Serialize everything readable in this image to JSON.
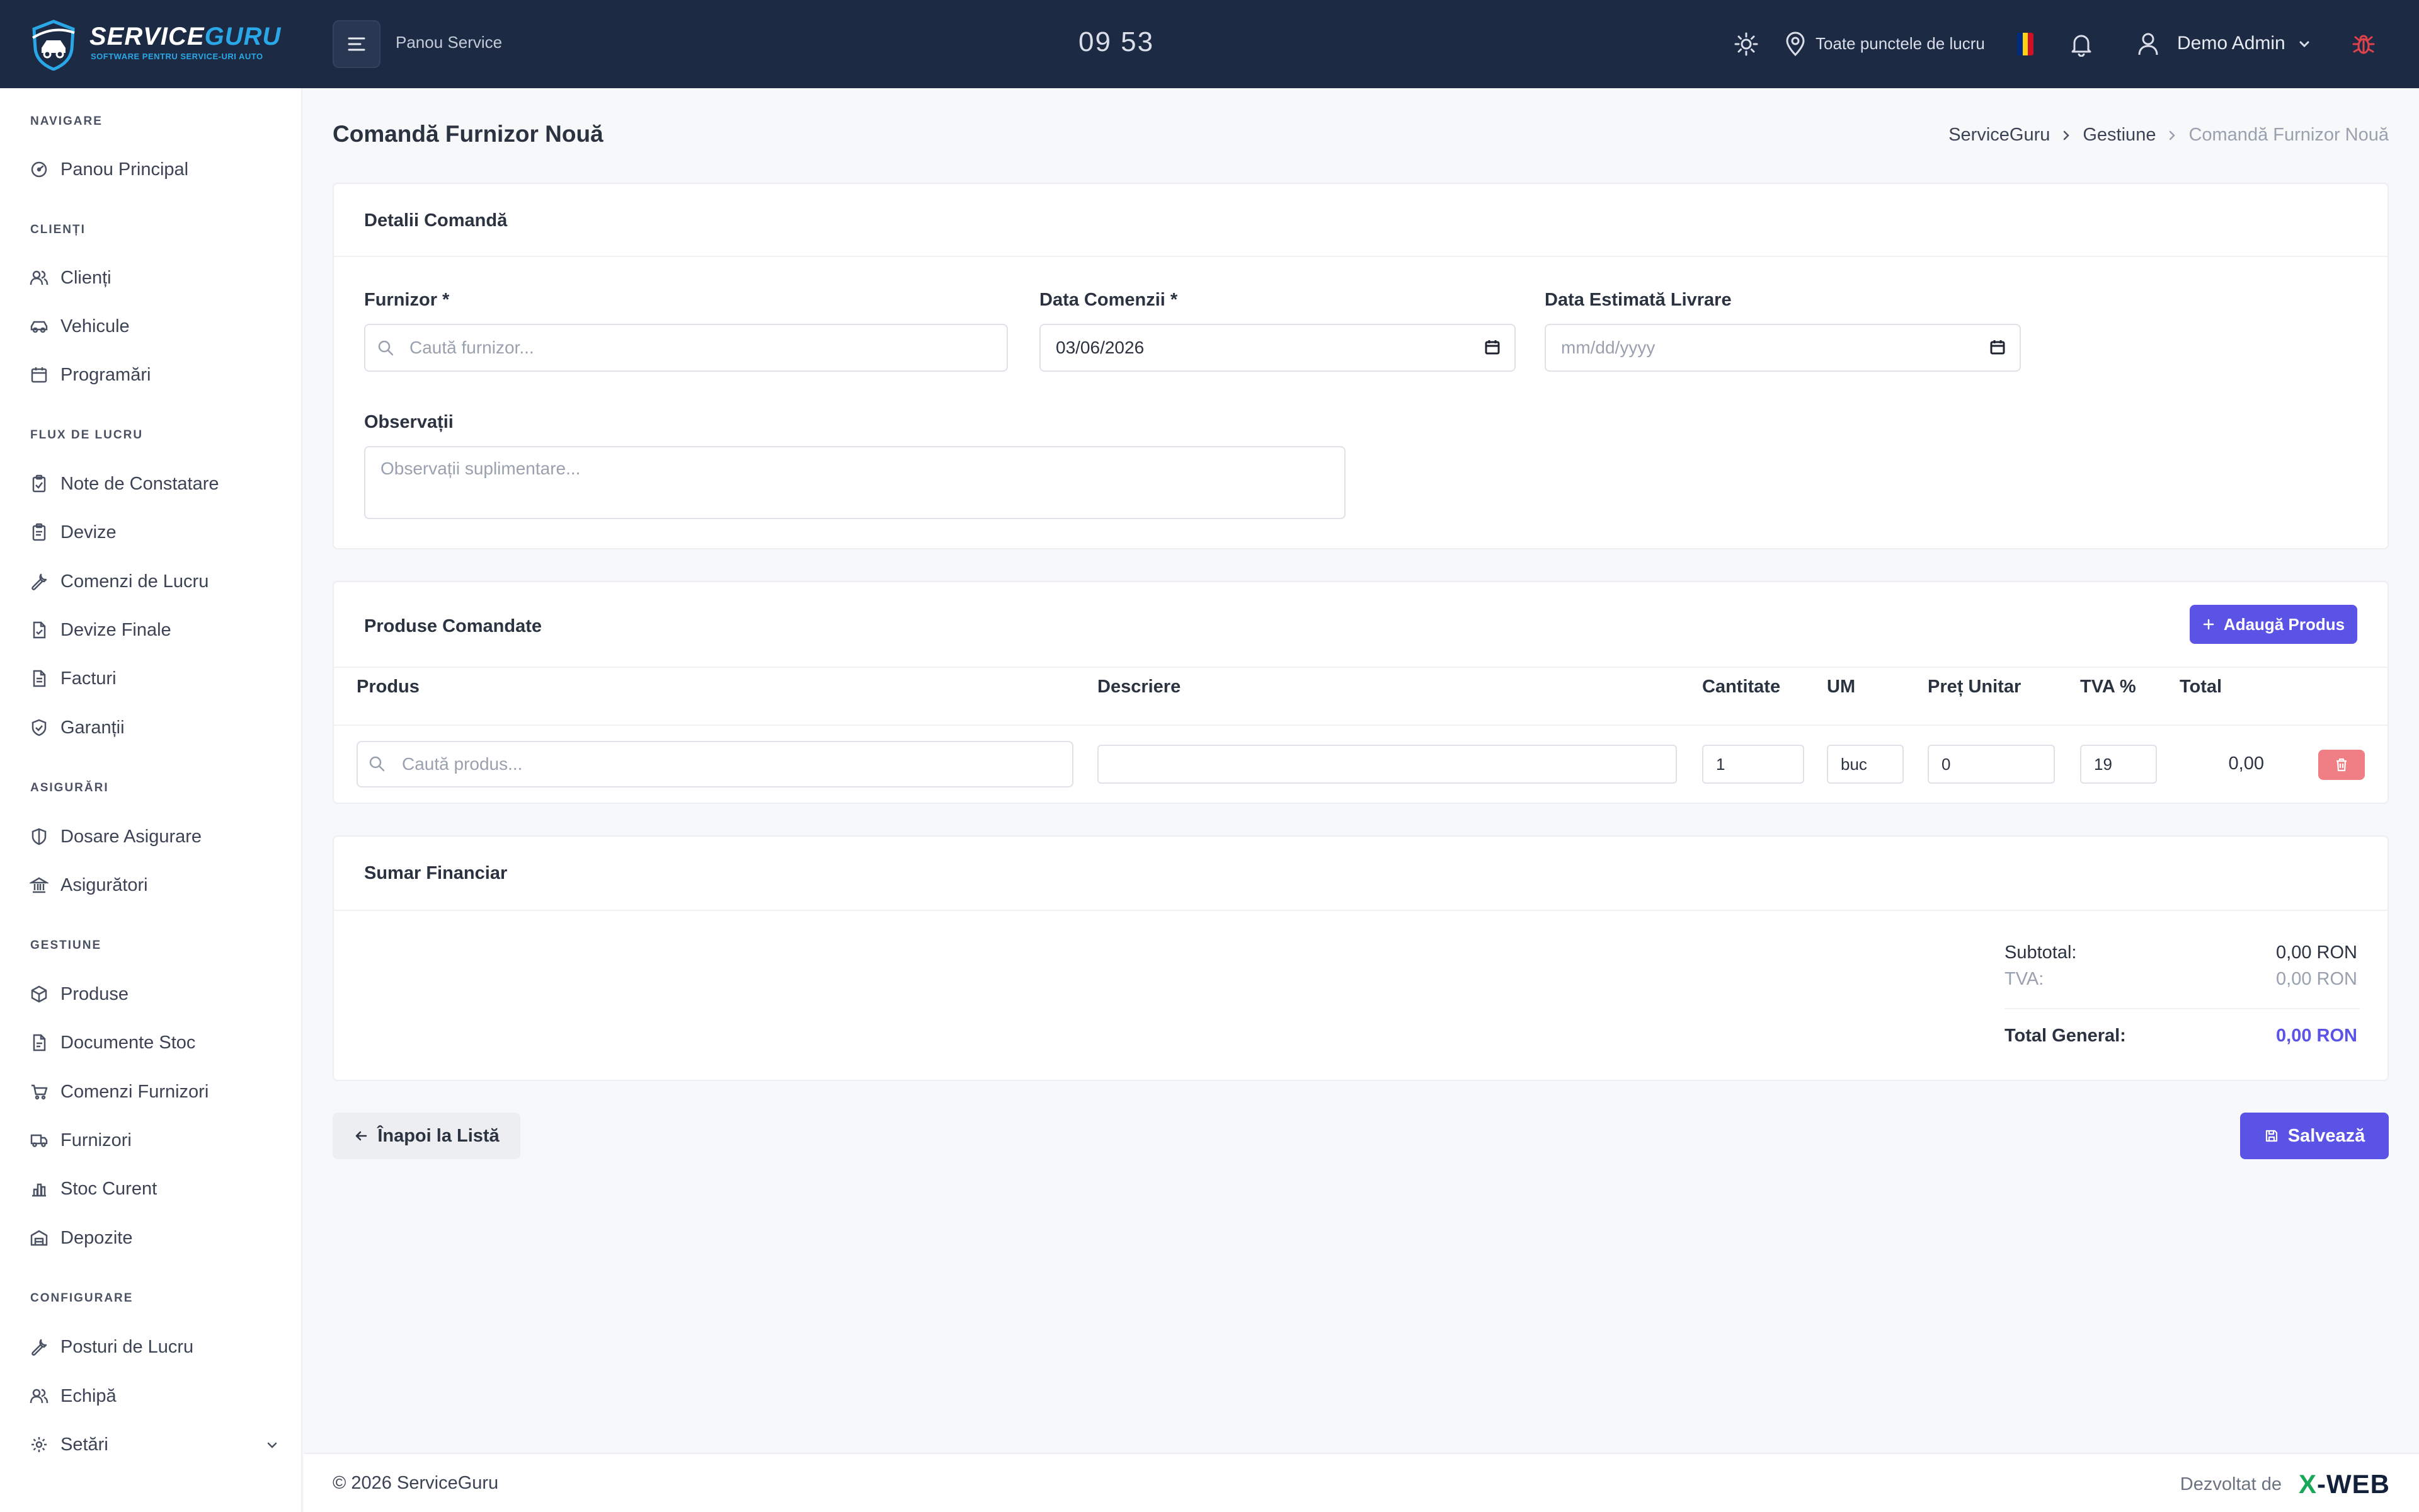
{
  "header": {
    "logo_text_main": "SERVICE",
    "logo_text_accent": "GURU",
    "logo_tagline": "SOFTWARE PENTRU SERVICE-URI AUTO",
    "panel_title": "Panou Service",
    "clock": "09 53",
    "location_label": "Toate punctele de lucru",
    "user_name": "Demo Admin",
    "flag_colors": [
      "#002b7f",
      "#fcd116",
      "#ce1126"
    ],
    "icons": [
      "menu-icon",
      "sun-icon",
      "map-pin-icon",
      "bell-icon",
      "user-icon",
      "chevron-down-icon",
      "bug-icon"
    ]
  },
  "sidebar": {
    "sections": [
      {
        "title": "NAVIGARE",
        "items": [
          {
            "label": "Panou Principal",
            "icon": "dashboard-icon"
          }
        ]
      },
      {
        "title": "CLIENȚI",
        "items": [
          {
            "label": "Clienți",
            "icon": "users-icon"
          },
          {
            "label": "Vehicule",
            "icon": "car-icon"
          },
          {
            "label": "Programări",
            "icon": "calendar-icon"
          }
        ]
      },
      {
        "title": "FLUX DE LUCRU",
        "items": [
          {
            "label": "Note de Constatare",
            "icon": "clipboard-check-icon"
          },
          {
            "label": "Devize",
            "icon": "clipboard-icon"
          },
          {
            "label": "Comenzi de Lucru",
            "icon": "wrench-icon"
          },
          {
            "label": "Devize Finale",
            "icon": "file-check-icon"
          },
          {
            "label": "Facturi",
            "icon": "receipt-icon"
          },
          {
            "label": "Garanții",
            "icon": "shield-check-icon"
          }
        ]
      },
      {
        "title": "ASIGURĂRI",
        "items": [
          {
            "label": "Dosare Asigurare",
            "icon": "shield-icon"
          },
          {
            "label": "Asigurători",
            "icon": "building-icon"
          }
        ]
      },
      {
        "title": "GESTIUNE",
        "items": [
          {
            "label": "Produse",
            "icon": "box-icon"
          },
          {
            "label": "Documente Stoc",
            "icon": "file-icon"
          },
          {
            "label": "Comenzi Furnizori",
            "icon": "cart-icon"
          },
          {
            "label": "Furnizori",
            "icon": "truck-icon"
          },
          {
            "label": "Stoc Curent",
            "icon": "bar-chart-icon"
          },
          {
            "label": "Depozite",
            "icon": "warehouse-icon"
          }
        ]
      },
      {
        "title": "CONFIGURARE",
        "items": [
          {
            "label": "Posturi de Lucru",
            "icon": "wrench-icon"
          },
          {
            "label": "Echipă",
            "icon": "team-icon"
          },
          {
            "label": "Setări",
            "icon": "gear-icon"
          }
        ]
      }
    ]
  },
  "page": {
    "title": "Comandă Furnizor Nouă",
    "breadcrumb": [
      "ServiceGuru",
      "Gestiune",
      "Comandă Furnizor Nouă"
    ]
  },
  "details": {
    "title": "Detalii Comandă",
    "supplier_label": "Furnizor *",
    "supplier_placeholder": "Caută furnizor...",
    "order_date_label": "Data Comenzii *",
    "order_date_value": "03/06/2026",
    "delivery_label": "Data Estimată Livrare",
    "delivery_placeholder": "mm/dd/yyyy",
    "notes_label": "Observații",
    "notes_placeholder": "Observații suplimentare..."
  },
  "products": {
    "title": "Produse Comandate",
    "add_button": "Adaugă Produs",
    "columns": [
      "Produs",
      "Descriere",
      "Cantitate",
      "UM",
      "Preț Unitar",
      "TVA %",
      "Total"
    ],
    "rows": [
      {
        "product_placeholder": "Caută produs...",
        "description": "",
        "quantity": "1",
        "unit": "buc",
        "unit_price": "0",
        "vat": "19",
        "total": "0,00"
      }
    ]
  },
  "summary": {
    "title": "Sumar Financiar",
    "subtotal_label": "Subtotal:",
    "subtotal_value": "0,00 RON",
    "vat_label": "TVA:",
    "vat_value": "0,00 RON",
    "total_label": "Total General:",
    "total_value": "0,00 RON",
    "total_color": "#5b53e6"
  },
  "actions": {
    "back_label": "Înapoi la Listă",
    "save_label": "Salvează"
  },
  "footer": {
    "copyright": "© 2026 ServiceGuru",
    "developed_by": "Dezvoltat de",
    "brand_x": "X",
    "brand_rest": "-WEB"
  }
}
